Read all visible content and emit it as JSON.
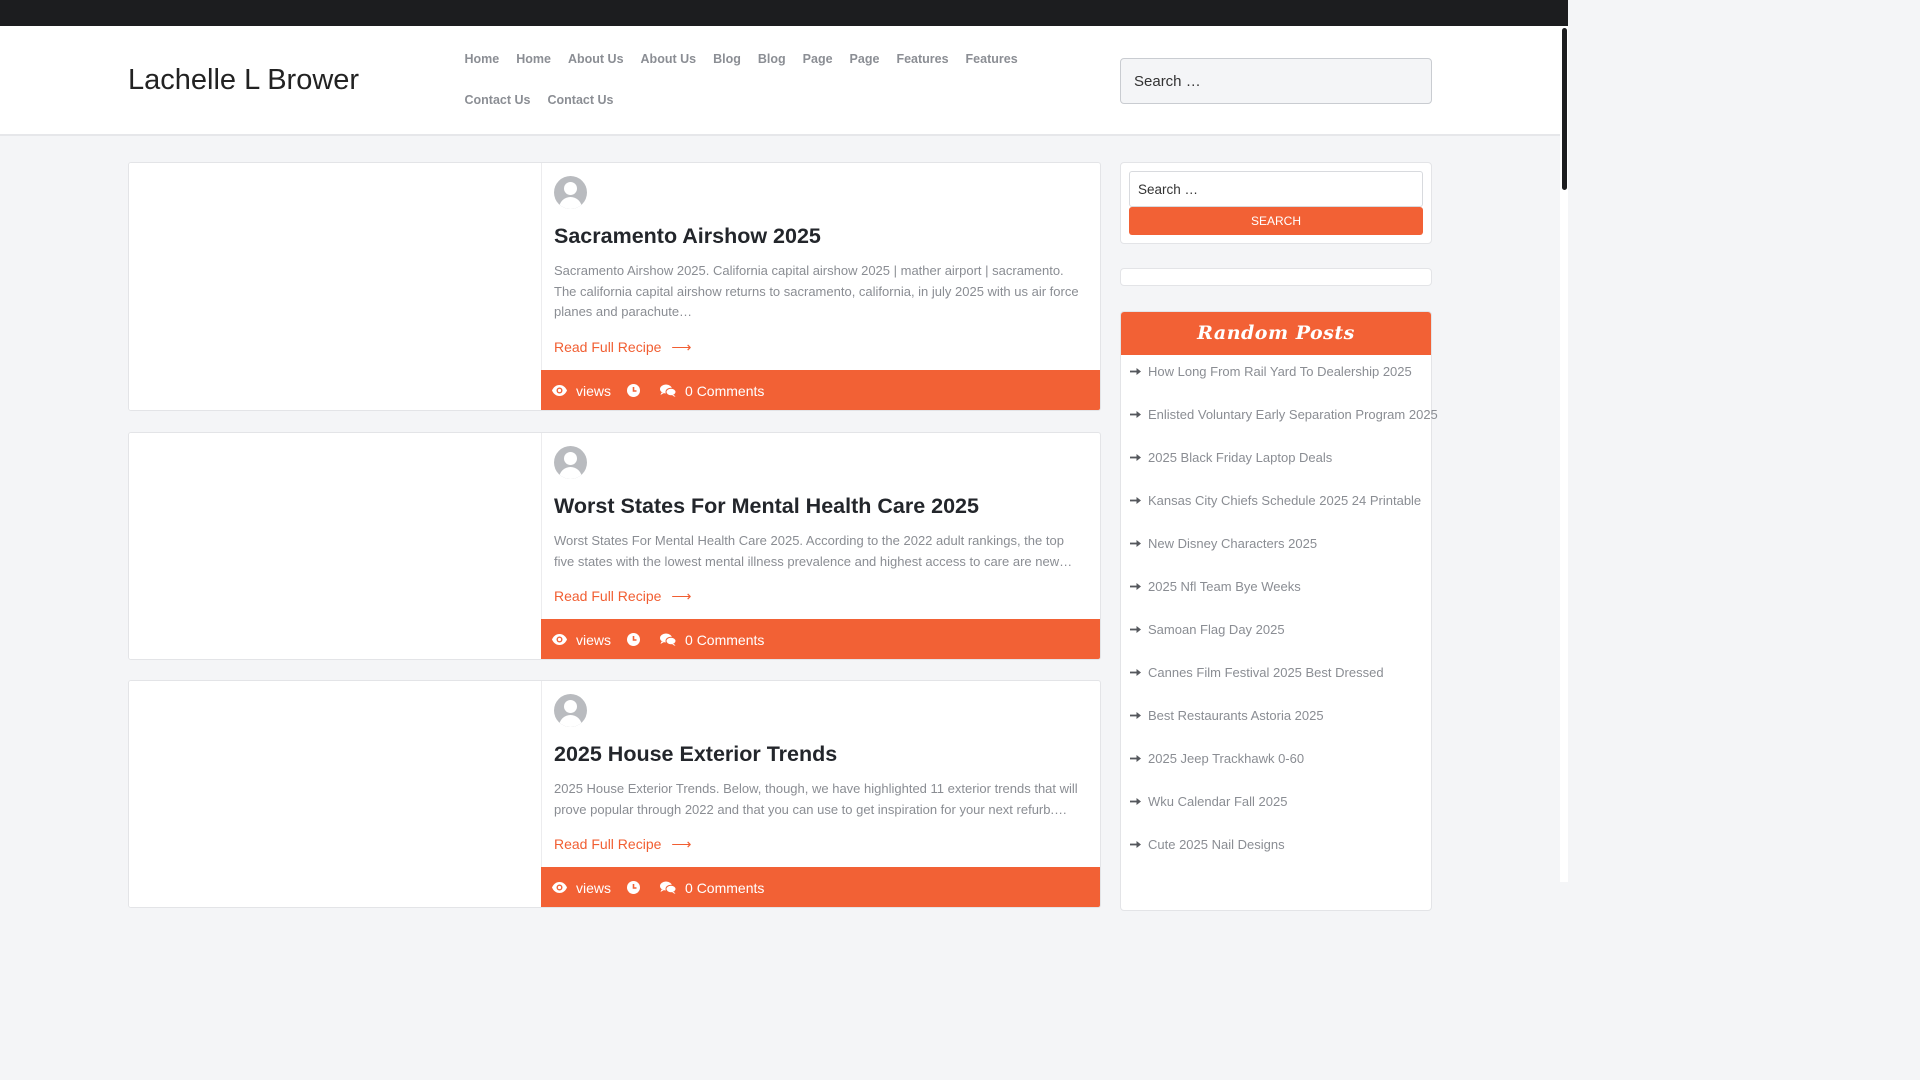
{
  "site": {
    "title": "Lachelle L Brower"
  },
  "nav": {
    "items": [
      "Home",
      "Home",
      "About Us",
      "About Us",
      "Blog",
      "Blog",
      "Page",
      "Page",
      "Features",
      "Features",
      "Contact Us",
      "Contact Us"
    ]
  },
  "header_search": {
    "placeholder": "Search …"
  },
  "posts": [
    {
      "title": "Sacramento Airshow 2025",
      "excerpt": "Sacramento Airshow 2025. California capital airshow 2025 | mather airport | sacramento. The california capital airshow returns to sacramento, california, in july 2025 with us air force planes and parachute…",
      "read_more": "Read Full Recipe",
      "views": "views",
      "comments": "0 Comments"
    },
    {
      "title": "Worst States For Mental Health Care 2025",
      "excerpt": "Worst States For Mental Health Care 2025. According to the 2022 adult rankings, the top five states with the lowest mental illness prevalence and highest access to care are new…",
      "read_more": "Read Full Recipe",
      "views": "views",
      "comments": "0 Comments"
    },
    {
      "title": "2025 House Exterior Trends",
      "excerpt": "2025 House Exterior Trends. Below, though, we have highlighted 11 exterior trends that will prove popular through 2022 and that you can use to get inspiration for your next refurb.…",
      "read_more": "Read Full Recipe",
      "views": "views",
      "comments": "0 Comments"
    }
  ],
  "sidebar": {
    "search": {
      "placeholder": "Search …",
      "button": "Search"
    },
    "random_posts": {
      "title": "Random Posts",
      "items": [
        "How Long From Rail Yard To Dealership 2025",
        "Enlisted Voluntary Early Separation Program 2025",
        "2025 Black Friday Laptop Deals",
        "Kansas City Chiefs Schedule 2025 24 Printable",
        "New Disney Characters 2025",
        "2025 Nfl Team Bye Weeks",
        "Samoan Flag Day 2025",
        "Cannes Film Festival 2025 Best Dressed",
        "Best Restaurants Astoria 2025",
        "2025 Jeep Trackhawk 0-60",
        "Wku Calendar Fall 2025",
        "Cute 2025 Nail Designs"
      ]
    }
  },
  "colors": {
    "accent": "#f26135",
    "topbar": "#1c1d1f",
    "title": "#23262b",
    "muted": "#8a8d93"
  }
}
